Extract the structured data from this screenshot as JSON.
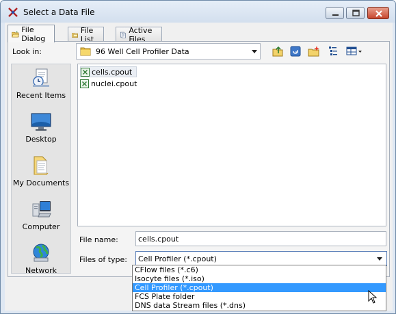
{
  "window": {
    "title": "Select a Data File",
    "minimize_icon": "minimize-icon",
    "maximize_icon": "maximize-icon",
    "close_icon": "close-icon"
  },
  "tabs": [
    {
      "label": "File Dialog",
      "icon": "folder-open-icon",
      "active": true
    },
    {
      "label": "File List",
      "icon": "folder-icon",
      "active": false
    },
    {
      "label": "Active Files",
      "icon": "files-icon",
      "active": false
    }
  ],
  "look_in": {
    "label": "Look in:",
    "value": "96 Well Cell Profiler Data"
  },
  "toolbar_icons": [
    "up-folder-icon",
    "desktop-icon",
    "new-folder-icon",
    "list-view-icon",
    "details-view-icon"
  ],
  "places": [
    {
      "label": "Recent Items",
      "icon": "recent-items-icon"
    },
    {
      "label": "Desktop",
      "icon": "desktop-icon"
    },
    {
      "label": "My Documents",
      "icon": "my-documents-icon"
    },
    {
      "label": "Computer",
      "icon": "computer-icon"
    },
    {
      "label": "Network",
      "icon": "network-icon"
    }
  ],
  "files": [
    {
      "name": "cells.cpout",
      "selected": true
    },
    {
      "name": "nuclei.cpout",
      "selected": false
    }
  ],
  "file_name": {
    "label": "File name:",
    "value": "cells.cpout"
  },
  "file_type": {
    "label": "Files of type:",
    "value": "Cell Profiler (*.cpout)",
    "options": [
      "CFlow files (*.c6)",
      "Isocyte files (*.iso)",
      "Cell Profiler (*.cpout)",
      "FCS Plate folder",
      "DNS data Stream files (*.dns)"
    ],
    "highlighted_index": 2
  },
  "colors": {
    "highlight": "#3399ff",
    "title_bar": "#dfe8f3"
  }
}
